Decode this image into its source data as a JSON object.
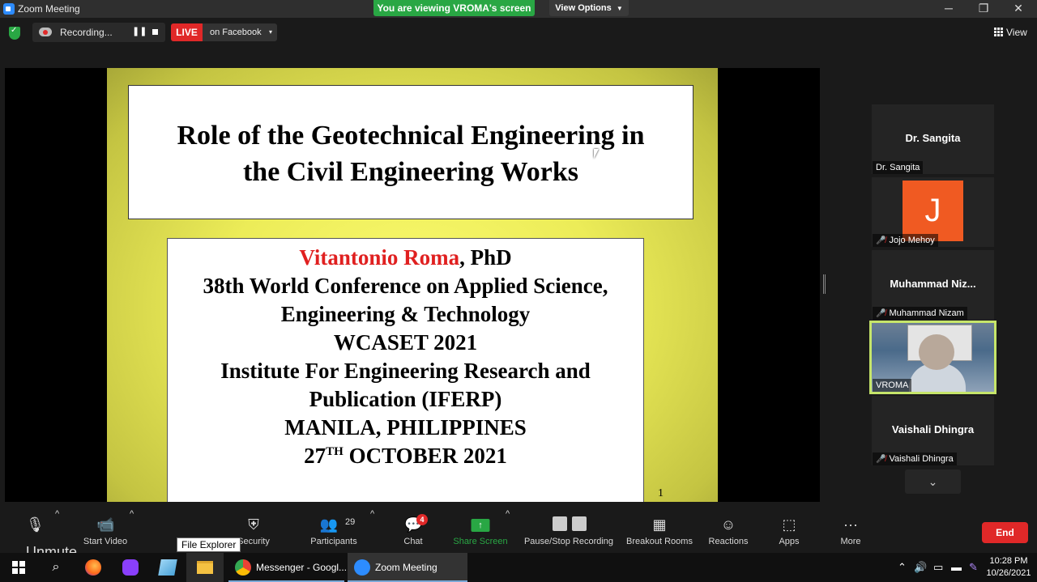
{
  "window": {
    "title": "Zoom Meeting",
    "viewing_banner": "You are viewing VROMA's screen",
    "view_options": "View Options",
    "minimize": "─",
    "restore": "❐",
    "close": "✕"
  },
  "topbar": {
    "recording_label": "Recording...",
    "pause_glyph": "❚❚",
    "live_label": "LIVE",
    "live_destination": "on Facebook",
    "live_caret": "▾",
    "view_label": "View"
  },
  "slide": {
    "title_line1": "Role of the Geotechnical Engineering in",
    "title_line2": "the Civil Engineering Works",
    "presenter_name": "Vitantonio Roma",
    "presenter_suffix": ", PhD",
    "lines": [
      "38th World Conference on Applied Science,",
      "Engineering & Technology",
      "WCASET 2021",
      "Institute For Engineering Research and",
      "Publication (IFERP)",
      "MANILA, PHILIPPINES"
    ],
    "date_day": "27",
    "date_sup": "TH",
    "date_rest": " OCTOBER 2021",
    "page_number": "1"
  },
  "gallery": {
    "participants": [
      {
        "big_name": "Dr. Sangita",
        "tag": "Dr. Sangita",
        "muted": false
      },
      {
        "avatar_letter": "J",
        "tag": "Jojo Mehoy",
        "muted": true
      },
      {
        "big_name": "Muhammad  Niz...",
        "tag": "Muhammad Nizam",
        "muted": true
      },
      {
        "tag": "VROMA",
        "muted": false,
        "active_speaker": true
      },
      {
        "big_name": "Vaishali Dhingra",
        "tag": "Vaishali Dhingra",
        "muted": true
      }
    ],
    "scroll_down": "⌄"
  },
  "toolbar": {
    "unmute": "Unmute",
    "start_video": "Start Video",
    "security": "Security",
    "participants": "Participants",
    "participants_count": "29",
    "chat": "Chat",
    "chat_badge": "4",
    "share_screen": "Share Screen",
    "pause_stop_recording": "Pause/Stop Recording",
    "breakout_rooms": "Breakout Rooms",
    "reactions": "Reactions",
    "apps": "Apps",
    "more": "More",
    "end": "End",
    "caret": "^"
  },
  "tooltip": "File Explorer",
  "taskbar": {
    "messenger": "Messenger - Googl...",
    "zoom": "Zoom Meeting",
    "time": "10:28 PM",
    "date": "10/26/2021"
  },
  "colors": {
    "accent_green": "#29a744",
    "live_red": "#e02828",
    "slide_yellow": "#ecec58",
    "presenter_red": "#e02020",
    "active_border": "#c6e56a",
    "avatar_orange": "#f05a22"
  }
}
